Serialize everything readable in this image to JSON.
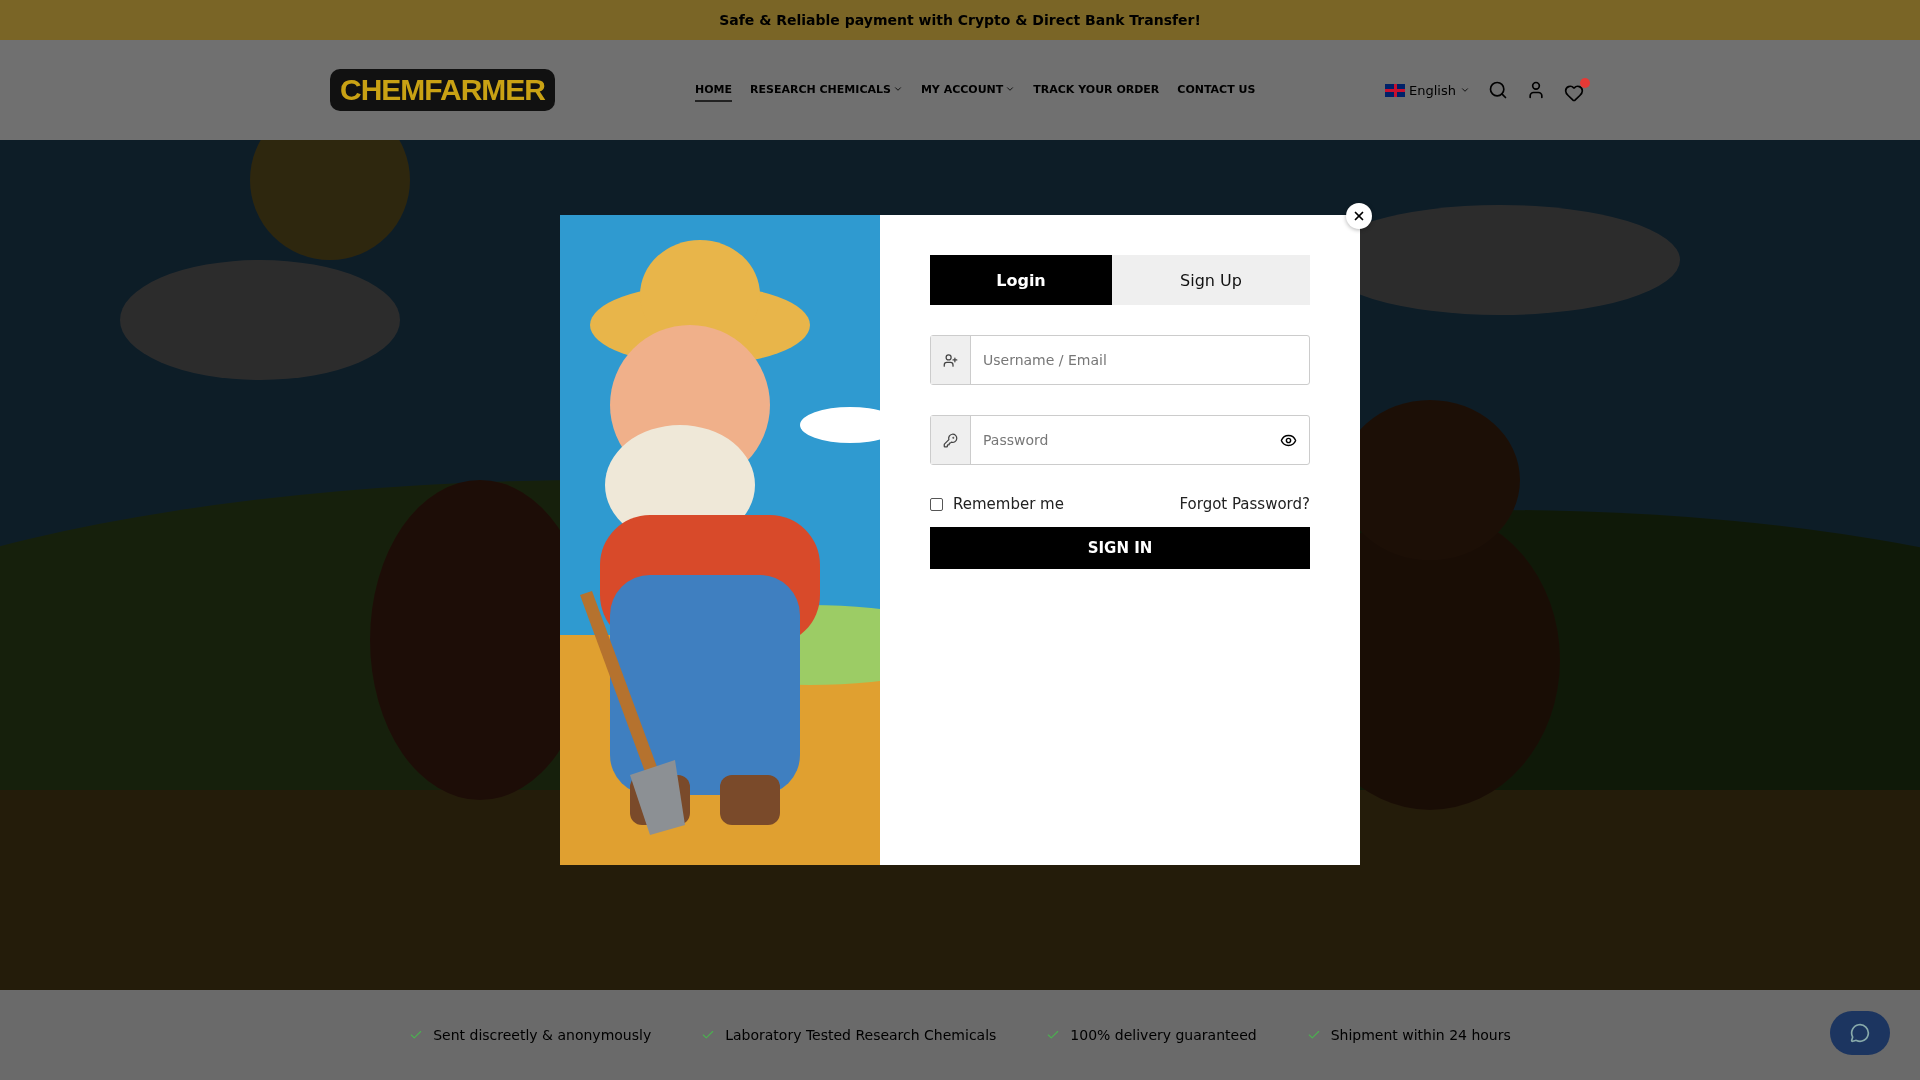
{
  "top_bar": {
    "text": "Safe & Reliable payment with Crypto & Direct Bank Transfer!"
  },
  "header": {
    "logo": "CHEMFARMER",
    "nav": [
      {
        "label": "HOME",
        "selected": true,
        "has_dropdown": false
      },
      {
        "label": "RESEARCH CHEMICALS",
        "selected": false,
        "has_dropdown": true
      },
      {
        "label": "MY ACCOUNT",
        "selected": false,
        "has_dropdown": true
      },
      {
        "label": "TRACK YOUR ORDER",
        "selected": false,
        "has_dropdown": false
      },
      {
        "label": "CONTACT US",
        "selected": false,
        "has_dropdown": false
      }
    ],
    "language": "English"
  },
  "hero": {
    "kind": "picture"
  },
  "features": [
    "Sent discreetly & anonymously",
    "Laboratory Tested Research Chemicals",
    "100% delivery guaranteed",
    "Shipment within 24 hours"
  ],
  "modal": {
    "image": {
      "kind": "picture"
    },
    "tabs": [
      {
        "label": "Login",
        "selected": true
      },
      {
        "label": "Sign Up",
        "selected": false
      }
    ],
    "username": {
      "placeholder": "Username / Email"
    },
    "password": {
      "placeholder": "Password"
    },
    "remember": {
      "label": "Remember me",
      "checked": false
    },
    "forgot": "Forgot Password?",
    "submit": "SIGN IN"
  }
}
